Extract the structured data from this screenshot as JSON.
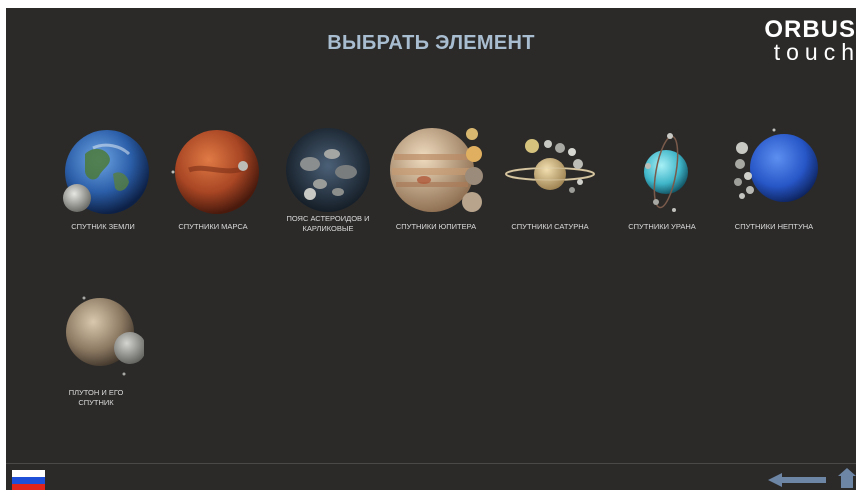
{
  "header": {
    "title": "ВЫБРАТЬ ЭЛЕМЕНТ",
    "logo_line1": "ORBUS",
    "logo_line2": "touch"
  },
  "tiles": [
    {
      "label": "СПУТНИК ЗЕМЛИ",
      "icon": "earth-moon-icon"
    },
    {
      "label": "СПУТНИКИ МАРСА",
      "icon": "mars-moons-icon"
    },
    {
      "label": "ПОЯС АСТЕРОИДОВ И КАРЛИКОВЫЕ",
      "icon": "asteroid-belt-icon"
    },
    {
      "label": "СПУТНИКИ ЮПИТЕРА",
      "icon": "jupiter-moons-icon"
    },
    {
      "label": "СПУТНИКИ САТУРНА",
      "icon": "saturn-moons-icon"
    },
    {
      "label": "СПУТНИКИ УРАНА",
      "icon": "uranus-moons-icon"
    },
    {
      "label": "СПУТНИКИ НЕПТУНА",
      "icon": "neptune-moons-icon"
    },
    {
      "label": "ПЛУТОН И ЕГО СПУТНИК",
      "icon": "pluto-charon-icon"
    }
  ],
  "footer": {
    "language_flag": "russia-flag-icon",
    "flag_colors": [
      "#ffffff",
      "#1f4fd6",
      "#e0241b"
    ],
    "back_icon": "back-arrow-icon",
    "home_icon": "home-icon"
  }
}
